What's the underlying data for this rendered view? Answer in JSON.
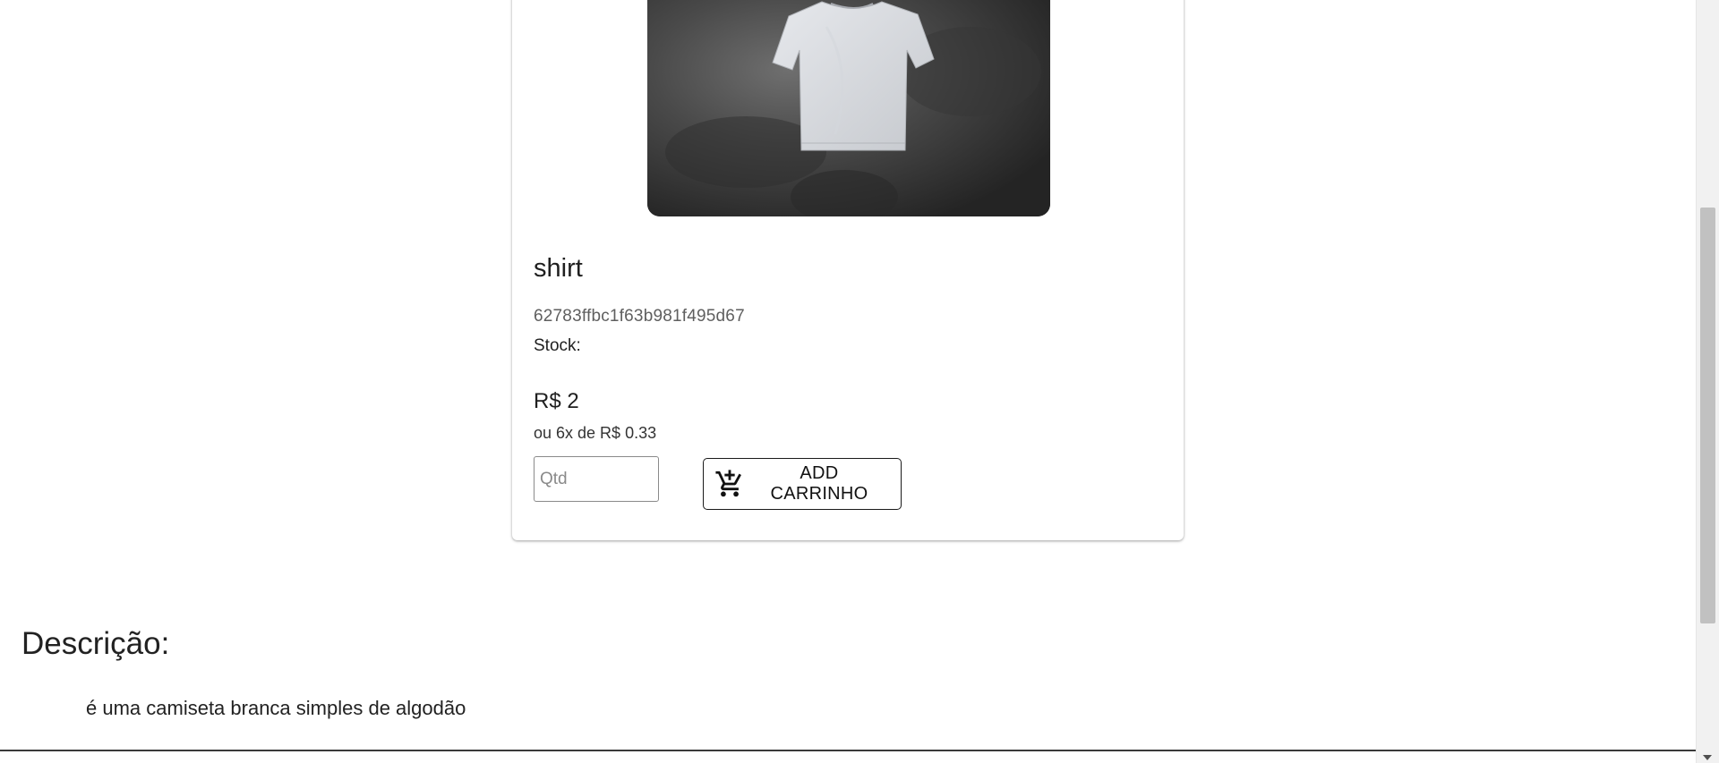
{
  "product": {
    "image_alt": "white t-shirt on hanger",
    "name": "shirt",
    "id": "62783ffbc1f63b981f495d67",
    "stock_label": "Stock:",
    "stock_value": "",
    "price": "R$ 2",
    "installments": "ou 6x de R$ 0.33",
    "qty_placeholder": "Qtd",
    "add_cart_label": "ADD CARRINHO",
    "add_cart_icon": "add-shopping-cart-icon"
  },
  "description": {
    "title": "Descrição:",
    "text": "é uma camiseta branca simples de algodão"
  },
  "colors": {
    "background": "#ffffff",
    "text": "#222222",
    "muted": "#5f5f5f",
    "button_border": "#1a1a1a",
    "scrollbar_thumb": "#c1c1c1"
  }
}
